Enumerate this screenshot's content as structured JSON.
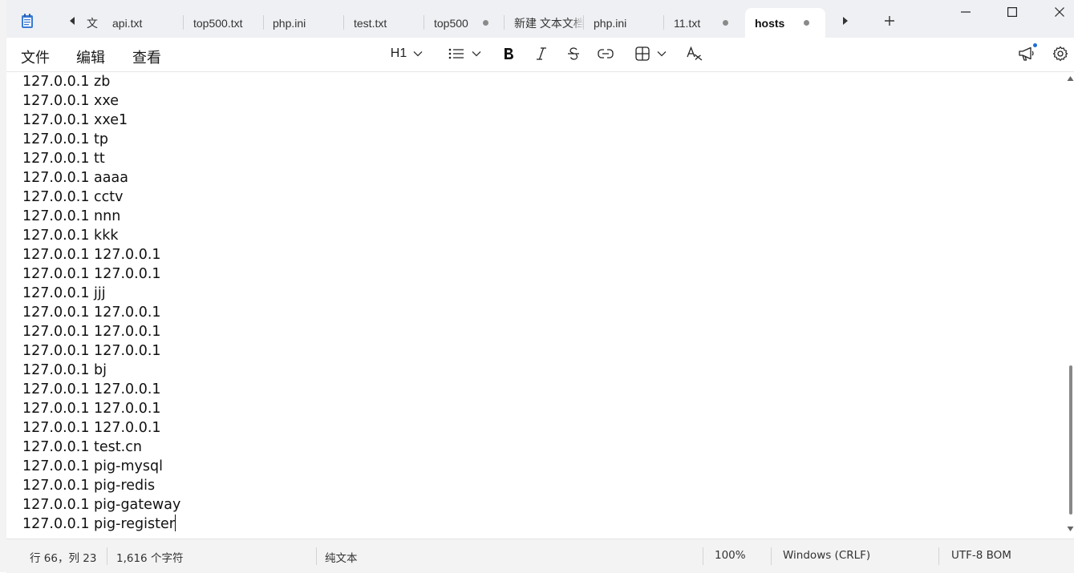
{
  "window": {
    "tabs": [
      {
        "label": "文",
        "active": false,
        "modified": false
      },
      {
        "label": "api.txt",
        "active": false,
        "modified": false
      },
      {
        "label": "top500.txt",
        "active": false,
        "modified": false
      },
      {
        "label": "php.ini",
        "active": false,
        "modified": false
      },
      {
        "label": "test.txt",
        "active": false,
        "modified": false
      },
      {
        "label": "top500",
        "active": false,
        "modified": true
      },
      {
        "label": "新建 文本文档",
        "active": false,
        "modified": false
      },
      {
        "label": "php.ini",
        "active": false,
        "modified": false
      },
      {
        "label": "11.txt",
        "active": false,
        "modified": true
      },
      {
        "label": "hosts",
        "active": true,
        "modified": true
      }
    ]
  },
  "menu": {
    "file": "文件",
    "edit": "编辑",
    "view": "查看"
  },
  "toolbar": {
    "heading": "H1"
  },
  "editor": {
    "lines": [
      "127.0.0.1 zb",
      "127.0.0.1 xxe",
      "127.0.0.1 xxe1",
      "127.0.0.1 tp",
      "127.0.0.1 tt",
      "127.0.0.1 aaaa",
      "127.0.0.1 cctv",
      "127.0.0.1 nnn",
      "127.0.0.1 kkk",
      "127.0.0.1 127.0.0.1",
      "127.0.0.1 127.0.0.1",
      "127.0.0.1 jjj",
      "127.0.0.1 127.0.0.1",
      "127.0.0.1 127.0.0.1",
      "127.0.0.1 127.0.0.1",
      "127.0.0.1 bj",
      "127.0.0.1 127.0.0.1",
      "127.0.0.1 127.0.0.1",
      "127.0.0.1 127.0.0.1",
      "127.0.0.1 test.cn",
      "127.0.0.1 pig-mysql",
      "127.0.0.1 pig-redis",
      "127.0.0.1 pig-gateway",
      "127.0.0.1 pig-register"
    ]
  },
  "status": {
    "position": "行 66，列 23",
    "char_count": "1,616 个字符",
    "format": "纯文本",
    "zoom": "100%",
    "line_ending": "Windows (CRLF)",
    "encoding": "UTF-8 BOM"
  },
  "colors": {
    "titlebar": "#eef0f3",
    "accent": "#1f6fd1",
    "statusbar": "#f3f3f3"
  }
}
